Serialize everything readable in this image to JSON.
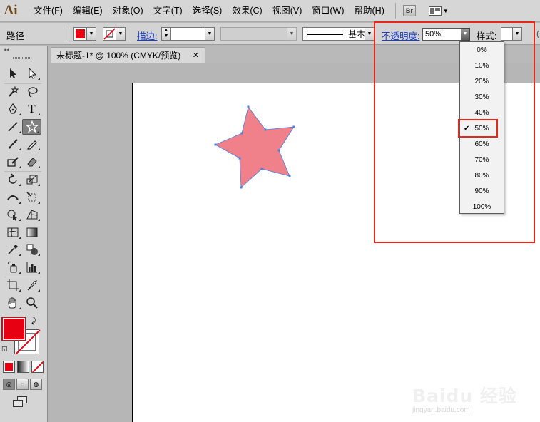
{
  "app": {
    "logo": "Ai",
    "menus": [
      "文件(F)",
      "编辑(E)",
      "对象(O)",
      "文字(T)",
      "选择(S)",
      "效果(C)",
      "视图(V)",
      "窗口(W)",
      "帮助(H)"
    ],
    "bridge_button": "Br"
  },
  "control_bar": {
    "selection_type": "路径",
    "stroke_link": "描边:",
    "stroke_style_name": "基本",
    "opacity_link": "不透明度:",
    "opacity_value": "50%",
    "style_label": "样式:",
    "fill_color": "#e60012"
  },
  "document": {
    "tab_title": "未标题-1* @ 100% (CMYK/预览)",
    "close_symbol": "✕"
  },
  "opacity_dropdown": {
    "options": [
      "0%",
      "10%",
      "20%",
      "30%",
      "40%",
      "50%",
      "60%",
      "70%",
      "80%",
      "90%",
      "100%"
    ],
    "selected": "50%",
    "check_mark": "✔"
  },
  "artwork": {
    "shape": "star",
    "fill": "#f08089",
    "stroke": "#4a7fe0"
  },
  "colors": {
    "highlight": "#e8271b",
    "fill_swatch": "#e60012"
  },
  "watermark": {
    "brand": "Baidu 经验",
    "url": "jingyan.baidu.com"
  }
}
